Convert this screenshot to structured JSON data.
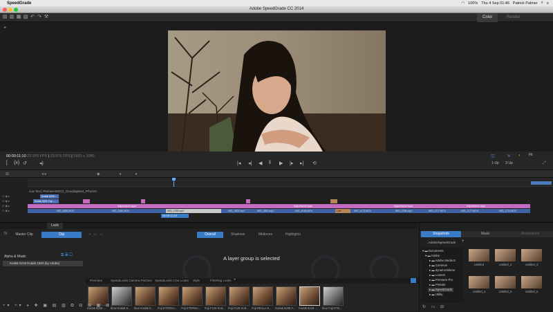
{
  "menubar": {
    "app": "SpeedGrade",
    "battery": "100%",
    "clock": "Thu 4 Sep 01:46",
    "user": "Patrick Palmer"
  },
  "window": {
    "title": "Adobe SpeedGrade CC 2014"
  },
  "workspace_tabs": [
    "Color",
    "Render"
  ],
  "transport": {
    "timecode": "00:00:11:10",
    "fps": "23.976 FPS",
    "fps2": "23.976 FPS",
    "resolution": "1920 x 1080",
    "view_a": "1-Up",
    "view_b": "3-Up",
    "zoom": "Fit"
  },
  "timeline": {
    "layer_label": "Live Text | PremiereMXCC_GroudingNext_PFazioV",
    "clip_top": "Kodak 5205 ...",
    "clip_top2": "Kodak 5201 Fuji ...",
    "adjustment": "Adjustment Layer",
    "clips": [
      "IMG_3855.MOV",
      "IMG_3960.MOV",
      "IMG_3785.mp4",
      "IMG_3800.mp4",
      "IMG_3850.mp4",
      "IMG_4015.MOV",
      "IMG_4173.MOV",
      "IMG_3785.mp4",
      "IMG_1177.MOV",
      "IMG_1177.MOV",
      "IMG_1714.MOV"
    ],
    "playhead": "00:00:11:10"
  },
  "bottom": {
    "tabs": [
      "Look"
    ],
    "master_clip": "Master Clip",
    "clip": "Clip",
    "layer_tabs": [
      "Overall",
      "Shadows",
      "Midtones",
      "Highlights"
    ],
    "alpha_mask": "Alpha & Mask:",
    "layer_item": "Kodak 5218 Kodak 2383 (by Adobe)",
    "status_message": "A layer group is selected",
    "preset_tabs": [
      "Premiere",
      "SpeedLooks Camera Patches",
      "SpeedLooks Cine Looks",
      "Style",
      "FilmFlag Looks"
    ],
    "presets": [
      "Kodak 5218 ...",
      "blow Kodak 5...",
      "blue Kodak 5...",
      "Fuji ETERNA...",
      "Fuji ETERNA...",
      "Fuji F125 Kod...",
      "Fuji F125 Kod...",
      "Fuji REALA 5...",
      "Kodak 5205 F...",
      "Kodak 5218 ...",
      "blue Fuji ETE..."
    ]
  },
  "right_panel": {
    "tabs": [
      "Snapshots",
      "Mask",
      "Annotations"
    ],
    "path": "..Adobe/SpeedGrade",
    "tree": [
      "Documents",
      "Adobe",
      "Adobe Media E",
      "Common",
      "dynamiclinkme",
      "Lumetri",
      "Premiere Pro",
      "Prelude",
      "SpeedGrade",
      "Utility"
    ],
    "snapshots": [
      "Untitled",
      "Untitled_2",
      "Untitled_3",
      "Untitled_4",
      "Untitled_5",
      "Untitled_6"
    ]
  }
}
